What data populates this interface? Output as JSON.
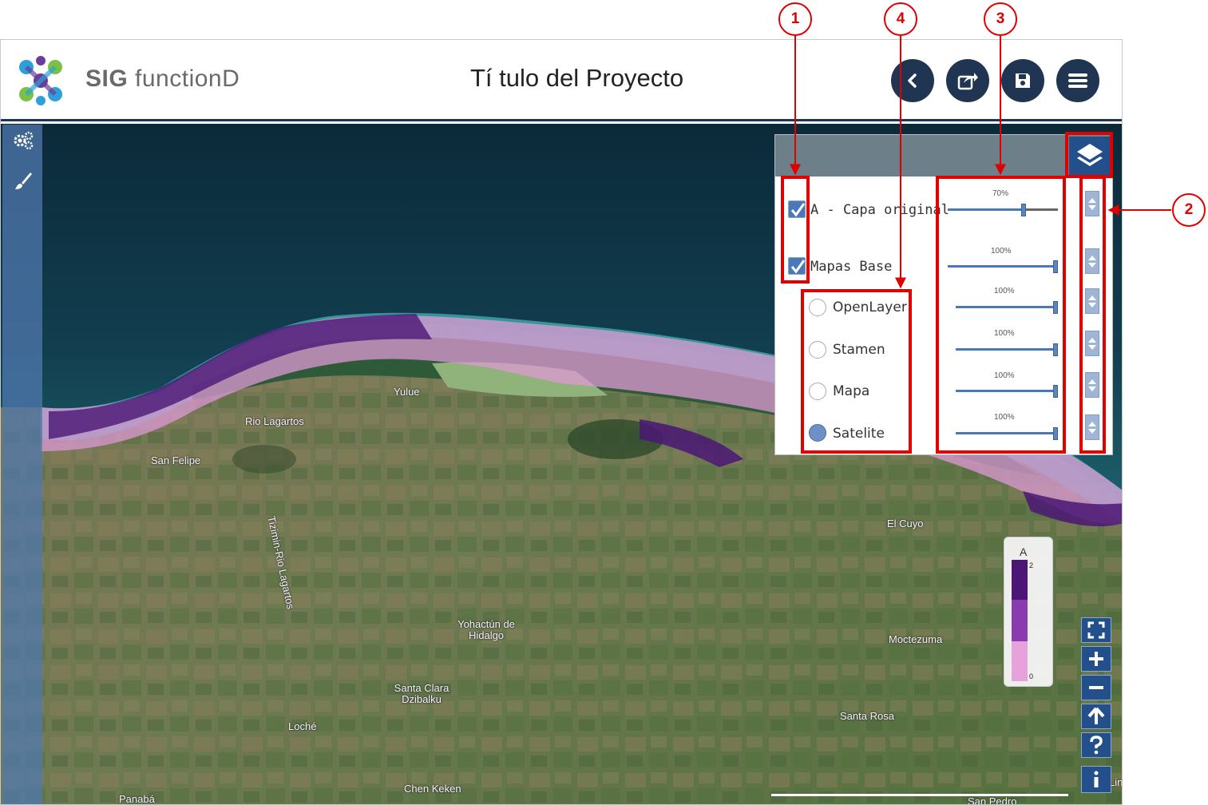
{
  "header": {
    "brand_prefix": "SIG",
    "brand_suffix": "functionD",
    "project_title": "Tí tulo del Proyecto",
    "buttons": [
      {
        "name": "back-button",
        "icon": "chevron-left-icon"
      },
      {
        "name": "share-button",
        "icon": "share-icon"
      },
      {
        "name": "save-button",
        "icon": "save-icon"
      },
      {
        "name": "menu-button",
        "icon": "hamburger-icon"
      }
    ]
  },
  "left_toolbar": [
    {
      "name": "settings-button",
      "icon": "gears-icon"
    },
    {
      "name": "style-button",
      "icon": "brush-icon"
    }
  ],
  "layer_panel": {
    "layers": [
      {
        "label": "A - Capa original",
        "checked": true,
        "opacity_label": "70%",
        "opacity": 0.7
      },
      {
        "label": "Mapas Base",
        "checked": true,
        "opacity_label": "100%",
        "opacity": 1.0
      }
    ],
    "base_maps": [
      {
        "label": "OpenLayer",
        "selected": false,
        "opacity_label": "100%",
        "opacity": 1.0
      },
      {
        "label": "Stamen",
        "selected": false,
        "opacity_label": "100%",
        "opacity": 1.0
      },
      {
        "label": "Mapa",
        "selected": false,
        "opacity_label": "100%",
        "opacity": 1.0
      },
      {
        "label": "Satelite",
        "selected": true,
        "opacity_label": "100%",
        "opacity": 1.0
      }
    ]
  },
  "legend": {
    "title": "A",
    "max": "2",
    "min": "0",
    "colors": [
      "#4b1675",
      "#8a3bb0",
      "#e7a2dc"
    ]
  },
  "map_places": {
    "rio_lagartos": "Rio Lagartos",
    "san_felipe": "San Felipe",
    "yulue": "Yulue",
    "tizimin": "Tizimin-Rio Lagartos",
    "el_cuyo": "El Cuyo",
    "yohactun": "Yohactún de Hidalgo",
    "moctezuma": "Moctezuma",
    "santa_clara": "Santa Clara Dzibalku",
    "loche": "Loché",
    "santa_rosa": "Santa Rosa",
    "chen_keken": "Chen Keken",
    "panaba": "Panabá",
    "san_pedro": "San Pedro",
    "lin": "Lin"
  },
  "zoom_controls": [
    "fullscreen-icon",
    "zoom-in-icon",
    "zoom-out-icon",
    "north-arrow-icon",
    "help-icon",
    "info-icon"
  ],
  "annotations": [
    "1",
    "2",
    "3",
    "4"
  ],
  "colors": {
    "header_dark": "#1f3552",
    "panel_blue": "#23508b",
    "annotation_red": "#e00000"
  }
}
